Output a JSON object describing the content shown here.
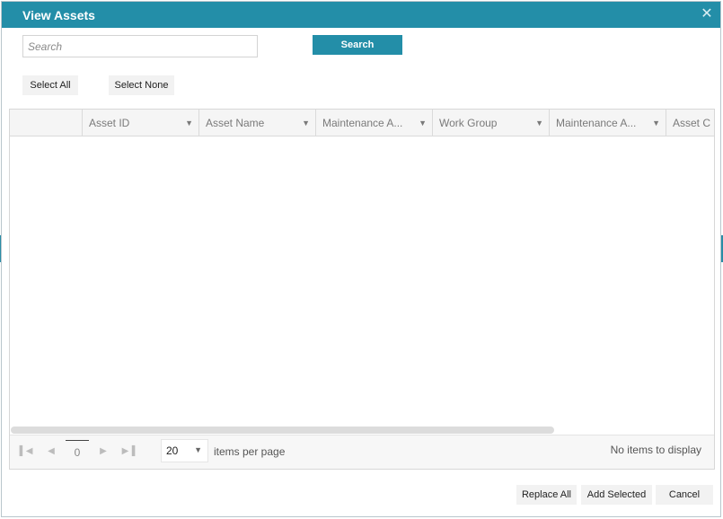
{
  "dialog": {
    "title": "View Assets",
    "close_icon": "close-icon",
    "accent_color": "#238ea8"
  },
  "search": {
    "placeholder": "Search",
    "value": "",
    "button_label": "Search"
  },
  "selection": {
    "select_all_label": "Select All",
    "select_none_label": "Select None"
  },
  "grid": {
    "columns": [
      {
        "label": ""
      },
      {
        "label": "Asset ID"
      },
      {
        "label": "Asset Name"
      },
      {
        "label": "Maintenance A..."
      },
      {
        "label": "Work Group"
      },
      {
        "label": "Maintenance A..."
      },
      {
        "label": "Asset C"
      }
    ],
    "rows": []
  },
  "pager": {
    "current_page": "0",
    "page_size": "20",
    "per_page_label": "items per page",
    "status": "No items to display"
  },
  "footer": {
    "replace_all_label": "Replace All",
    "add_selected_label": "Add Selected",
    "cancel_label": "Cancel"
  }
}
